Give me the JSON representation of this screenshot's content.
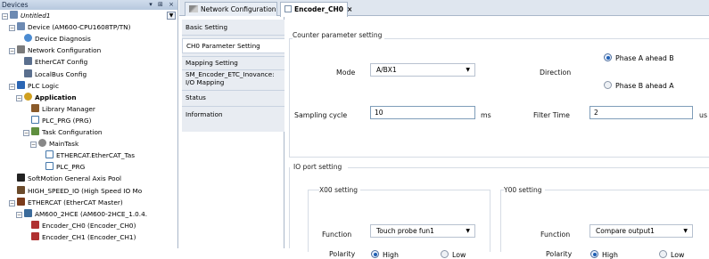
{
  "devices_panel": {
    "title": "Devices",
    "header_controls": "▾ ⊞ ×",
    "tree": [
      {
        "label": "Untitled1",
        "indent": 0,
        "icon": "project-icon",
        "exp": "−",
        "style": "italic"
      },
      {
        "label": "Device (AM600-CPU1608TP/TN)",
        "indent": 1,
        "icon": "device-icon",
        "exp": "−"
      },
      {
        "label": "Device Diagnosis",
        "indent": 2,
        "icon": "diagnosis-icon",
        "exp": ""
      },
      {
        "label": "Network Configuration",
        "indent": 1,
        "icon": "network-icon",
        "exp": "−"
      },
      {
        "label": "EtherCAT Config",
        "indent": 2,
        "icon": "ethercat-config-icon",
        "exp": ""
      },
      {
        "label": "LocalBus Config",
        "indent": 2,
        "icon": "localbus-config-icon",
        "exp": ""
      },
      {
        "label": "PLC Logic",
        "indent": 1,
        "icon": "plc-logic-icon",
        "exp": "−"
      },
      {
        "label": "Application",
        "indent": 2,
        "icon": "application-icon",
        "exp": "−",
        "style": "bold"
      },
      {
        "label": "Library Manager",
        "indent": 3,
        "icon": "library-icon",
        "exp": ""
      },
      {
        "label": "PLC_PRG (PRG)",
        "indent": 3,
        "icon": "program-icon",
        "exp": ""
      },
      {
        "label": "Task Configuration",
        "indent": 3,
        "icon": "task-config-icon",
        "exp": "−"
      },
      {
        "label": "MainTask",
        "indent": 4,
        "icon": "maintask-icon",
        "exp": "−"
      },
      {
        "label": "ETHERCAT.EtherCAT_Tas",
        "indent": 5,
        "icon": "task-call-icon",
        "exp": ""
      },
      {
        "label": "PLC_PRG",
        "indent": 5,
        "icon": "task-call-icon",
        "exp": ""
      },
      {
        "label": "SoftMotion General Axis Pool",
        "indent": 1,
        "icon": "axis-pool-icon",
        "exp": ""
      },
      {
        "label": "HIGH_SPEED_IO (High Speed IO Mo",
        "indent": 1,
        "icon": "highspeed-io-icon",
        "exp": ""
      },
      {
        "label": "ETHERCAT (EtherCAT Master)",
        "indent": 1,
        "icon": "ethercat-master-icon",
        "exp": "−"
      },
      {
        "label": "AM600_2HCE (AM600-2HCE_1.0.4.",
        "indent": 2,
        "icon": "slave-module-icon",
        "exp": "−"
      },
      {
        "label": "Encoder_CH0 (Encoder_CH0)",
        "indent": 3,
        "icon": "encoder-icon",
        "exp": ""
      },
      {
        "label": "Encoder_CH1 (Encoder_CH1)",
        "indent": 3,
        "icon": "encoder-icon",
        "exp": ""
      }
    ]
  },
  "tabs": [
    {
      "label": "Network Configuration",
      "active": false
    },
    {
      "label": "Encoder_CH0",
      "active": true,
      "close": "×"
    }
  ],
  "side_tabs": [
    "Basic Setting",
    "CH0 Parameter Setting",
    "Mapping Setting",
    "SM_Encoder_ETC_Inovance: I/O Mapping",
    "Status",
    "Information"
  ],
  "side_tab_active": 1,
  "counter": {
    "group_title": "Counter parameter setting",
    "mode_label": "Mode",
    "mode_value": "A/BX1",
    "direction_label": "Direction",
    "direction_option_a": "Phase A ahead B",
    "direction_option_b": "Phase B ahead A",
    "direction_selected": "a",
    "sampling_label": "Sampling cycle",
    "sampling_value": "10",
    "sampling_unit": "ms",
    "filter_label": "Filter Time",
    "filter_value": "2",
    "filter_unit": "us"
  },
  "io_port": {
    "group_title": "IO port setting",
    "x00": {
      "title": "X00 setting",
      "function_label": "Function",
      "function_value": "Touch probe fun1",
      "polarity_label": "Polarity",
      "high_label": "High",
      "low_label": "Low",
      "selected": "high"
    },
    "y00": {
      "title": "Y00 setting",
      "function_label": "Function",
      "function_value": "Compare output1",
      "polarity_label": "Polarity",
      "high_label": "High",
      "low_label": "Low",
      "selected": "high"
    }
  },
  "colors": {
    "panel_header": "#b7c8de",
    "accent": "#1e5fb4",
    "border": "#a9b7c9"
  }
}
